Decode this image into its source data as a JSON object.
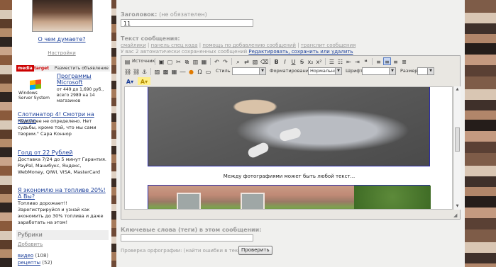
{
  "sidebar": {
    "what_think": "О чем думаете?",
    "settings": "Настройки",
    "ad_header": {
      "logo": "media",
      "target": "target",
      "place_ad": "Разместить объявление"
    },
    "ads": [
      {
        "title": "Программы Microsoft",
        "body": "от 449 до 1,690 руб., всего 2989 на 14 магазинов",
        "logo_text": "Windows Server System"
      },
      {
        "title": "Слотинатор 4! Смотри на компе",
        "body": "\"Будущее не определено. Нет судьбы, кроме той, что мы сами творим.\" Сара Коннор"
      },
      {
        "title": "Голд от 22 Рублей",
        "body": "Доставка 7/24 до 5 минут Гарантия. PayPal, Манибукс, Яндекс, WebMoney, QIWI, VISA, MasterCard"
      },
      {
        "title": "Я экономлю на топливе 20%! А Вы?",
        "body": "Топливо дорожает!! Зарегистрируйся и узнай как экономить до 30% топлива и даже заработать на этом!"
      }
    ],
    "rubrics": {
      "heading": "Рубрики",
      "add": "Добавить",
      "items": [
        {
          "name": "видео",
          "count": "(108)"
        },
        {
          "name": "рецепты",
          "count": "(52)"
        }
      ]
    }
  },
  "form": {
    "title_label": "Заголовок:",
    "title_optional": "(не обязателен)",
    "title_value": "11",
    "message_label": "Текст сообщения:",
    "links": [
      "смайлики",
      "панель спец кода",
      "помощь по добавлению сообщений",
      "транслит сообщения"
    ],
    "autosave_text": "У вас 2 автоматически сохраненных сообщений",
    "autosave_link": "Редактировать, сохранить или удалить",
    "toolbar": {
      "source": "Источник",
      "style_label": "Стиль",
      "format_label": "Форматирование",
      "format_value": "Нормальный",
      "font_label": "Шрифт",
      "size_label": "Размер"
    },
    "caption": "Между фотографиями может быть любой текст...",
    "keywords_label": "Ключевые слова (теги) в этом сообщении:",
    "spell_text": "Проверка орфографии: (найти ошибки в тексте)",
    "check_button": "Проверить"
  },
  "icons": {
    "save": "save-icon",
    "new_page": "new-page-icon",
    "cut": "cut-icon",
    "copy": "copy-icon",
    "paste": "paste-icon",
    "undo": "undo-icon",
    "redo": "redo-icon",
    "bold": "bold-icon",
    "italic": "italic-icon",
    "underline": "underline-icon",
    "strike": "strikethrough-icon"
  },
  "colors": {
    "link": "#1b3f9a",
    "ad_brand": "#cc0000",
    "muted": "#999999"
  }
}
